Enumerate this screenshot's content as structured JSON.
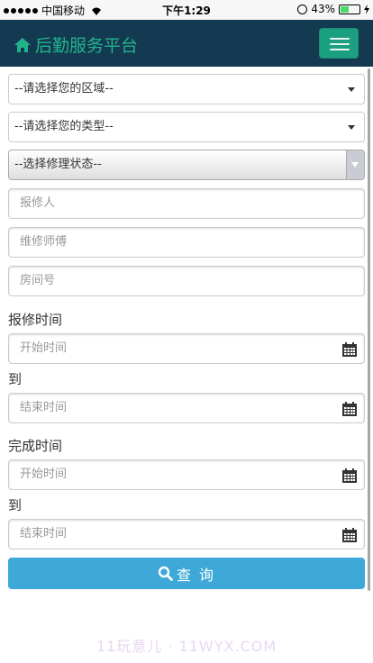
{
  "status_bar": {
    "carrier": "中国移动",
    "time": "下午1:29",
    "battery": "43%"
  },
  "navbar": {
    "title": "后勤服务平台",
    "accent": "#21b48a",
    "background": "#143a52"
  },
  "filters": {
    "area_select": "--请选择您的区域--",
    "type_select": "--请选择您的类型--",
    "status_select": "--选择修理状态--"
  },
  "inputs": {
    "reporter_placeholder": "报修人",
    "technician_placeholder": "维修师傅",
    "room_placeholder": "房间号"
  },
  "report_time": {
    "label": "报修时间",
    "start_placeholder": "开始时间",
    "to_label": "到",
    "end_placeholder": "结束时间"
  },
  "complete_time": {
    "label": "完成时间",
    "start_placeholder": "开始时间",
    "to_label": "到",
    "end_placeholder": "结束时间"
  },
  "query_button": {
    "label": "查 询",
    "color": "#3ea9d8"
  },
  "watermark": "11玩意儿 · 11WYX.COM"
}
